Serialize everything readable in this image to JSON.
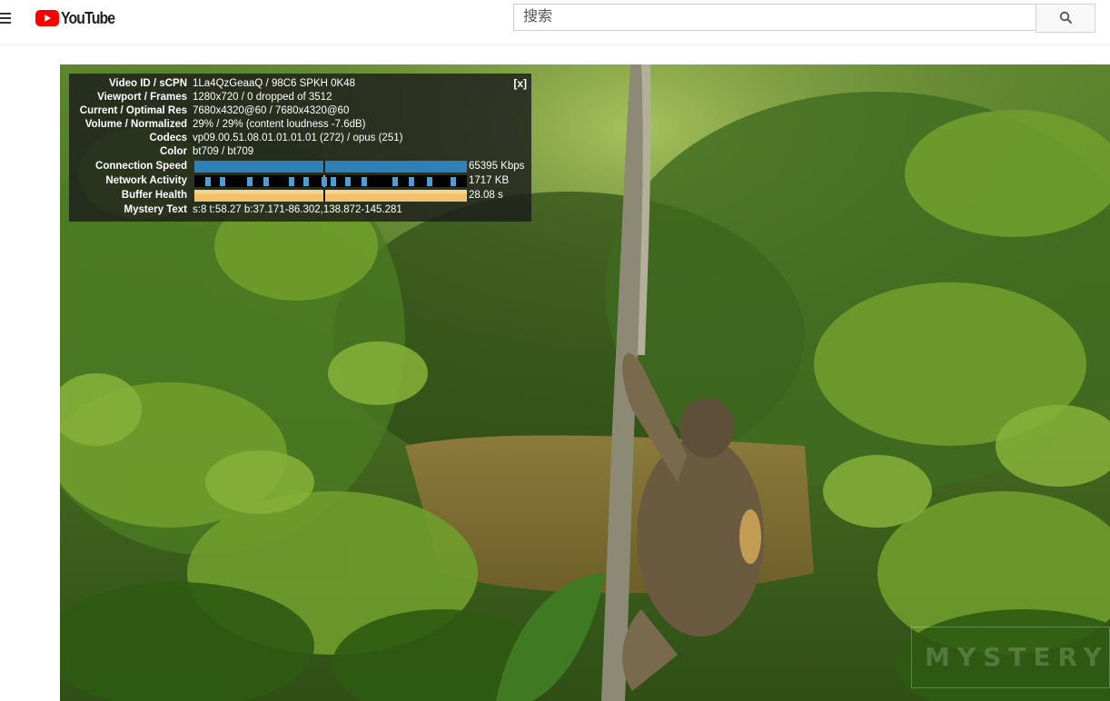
{
  "masthead": {
    "logo_text": "YouTube",
    "search_placeholder": "搜索",
    "icons": {
      "menu": "hamburger-menu-icon",
      "search": "magnifier-icon",
      "logo": "youtube-play-icon"
    },
    "colors": {
      "brand_red": "#ff0000"
    }
  },
  "stats": {
    "close_label": "[x]",
    "rows": [
      {
        "label": "Video ID / sCPN",
        "value": "1La4QzGeaaQ / 98C6 SPKH 0K48"
      },
      {
        "label": "Viewport / Frames",
        "value": "1280x720 / 0 dropped of 3512"
      },
      {
        "label": "Current / Optimal Res",
        "value": "7680x4320@60 / 7680x4320@60"
      },
      {
        "label": "Volume / Normalized",
        "value": "29% / 29% (content loudness -7.6dB)"
      },
      {
        "label": "Codecs",
        "value": "vp09.00.51.08.01.01.01.01 (272) / opus (251)"
      },
      {
        "label": "Color",
        "value": "bt709 / bt709"
      },
      {
        "label": "Connection Speed",
        "value": "65395 Kbps"
      },
      {
        "label": "Network Activity",
        "value": "1717 KB"
      },
      {
        "label": "Buffer Health",
        "value": "28.08 s"
      },
      {
        "label": "Mystery Text",
        "value": "s:8 t:58.27 b:37.171-86.302,138.872-145.281"
      }
    ],
    "colors": {
      "connection": "#2f80b7",
      "network_bar": "#4a9fd6",
      "buffer": "#f3c06d",
      "buffer_highlight": "#e79a3f"
    }
  },
  "watermark": {
    "text": "MYSTERY"
  }
}
